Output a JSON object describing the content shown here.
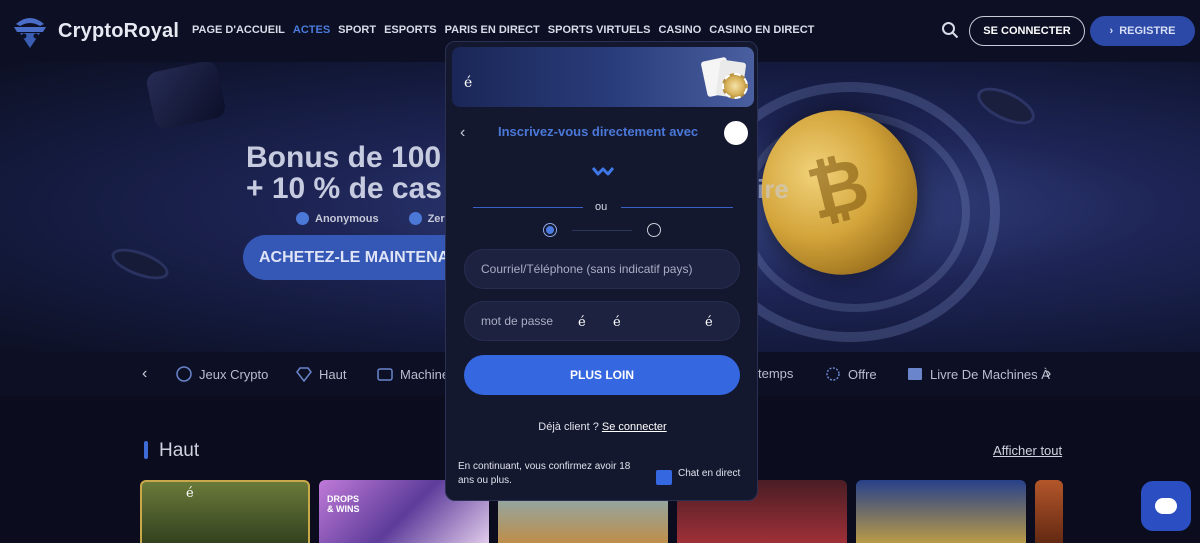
{
  "header": {
    "brand": "CryptoRoyal",
    "nav": [
      "PAGE D'ACCUEIL",
      "ACTES",
      "SPORT",
      "ESPORTS",
      "PARIS EN DIRECT",
      "SPORTS VIRTUELS",
      "CASINO",
      "CASINO EN DIRECT"
    ],
    "active_nav": "ACTES",
    "login_label": "SE CONNECTER",
    "register_label": "REGISTRE"
  },
  "hero": {
    "title_line1": "Bonus de 100",
    "title_line2": "+ 10 % de cas",
    "title_right": "ire",
    "check1": "Anonymous",
    "check2": "Zero",
    "cta": "ACHETEZ-LE MAINTENANT"
  },
  "categories": {
    "items": [
      "Jeux Crypto",
      "Haut",
      "Machine",
      "temps",
      "Offre",
      "Livre De Machines À"
    ]
  },
  "section": {
    "title": "Haut",
    "see_all": "Afficher tout",
    "tile_labels": [
      "é",
      "DROPS & WINS"
    ]
  },
  "modal": {
    "banner_char": "é",
    "heading": "Inscrivez-vous directement avec",
    "or": "ou",
    "email_placeholder": "Courriel/Téléphone (sans indicatif pays)",
    "password_placeholder": "mot de passe",
    "password_chars": [
      "é",
      "é",
      "é"
    ],
    "next_label": "PLUS LOIN",
    "already_text": "Déjà client ?",
    "already_link": "Se connecter",
    "legal": "En continuant, vous confirmez avoir 18 ans ou plus.",
    "chat_label": "Chat en direct"
  },
  "colors": {
    "accent": "#3567e0",
    "background": "#0b0d1f",
    "modal_bg": "#14182e"
  }
}
